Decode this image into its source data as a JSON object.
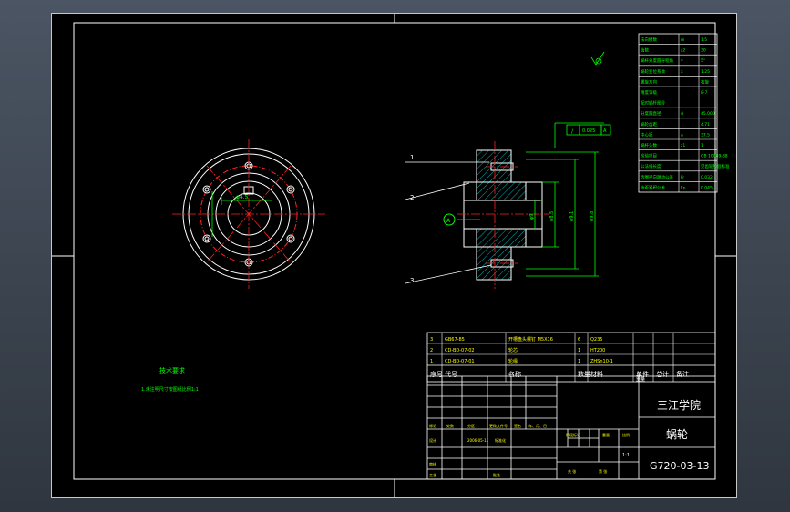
{
  "technical_requirements": {
    "heading": "技术要求",
    "item_1": "1.未注明尺寸按图纸比例1:1"
  },
  "section_views": {
    "left_circle_dim": "φ4.5",
    "view_marker": "A"
  },
  "side_view": {
    "callouts": [
      "1",
      "2",
      "3"
    ],
    "datum_tolerance": [
      "/",
      "0.025",
      "A"
    ],
    "diameter_labels": [
      "φ9",
      "φ8.5",
      "φ9.1",
      "φ9.8"
    ]
  },
  "parameter_table": {
    "rows": [
      [
        "法向模数",
        "m",
        "1.5"
      ],
      [
        "齿数",
        "z2",
        "30"
      ],
      [
        "蜗杆分度圆导程角",
        "γ",
        "5°"
      ],
      [
        "蜗轮变位系数",
        "x",
        "1.25"
      ],
      [
        "螺旋方向",
        "",
        "右旋"
      ],
      [
        "精度等级",
        "",
        "8-7"
      ],
      [
        "配对蜗杆图号",
        "",
        ""
      ],
      [
        "分度圆直径",
        "d",
        "45.000"
      ],
      [
        "蜗轮齿距",
        "",
        "4.71"
      ],
      [
        "中心距",
        "a",
        "37.5"
      ],
      [
        "蜗杆头数",
        "z1",
        "1"
      ],
      [
        "检验项目",
        "",
        "GB 10089-88"
      ],
      [
        "公法线长度",
        "",
        "见齿轮检验标准"
      ],
      [
        "齿圈径向跳动公差",
        "Fr",
        "0.032"
      ],
      [
        "齿距累积公差",
        "Fp",
        "0.045"
      ]
    ]
  },
  "parts_list": {
    "rows": [
      [
        "3",
        "GB67-85",
        "开槽盘头螺钉 M5X16",
        "6",
        "Q235",
        "",
        "",
        ""
      ],
      [
        "2",
        "CD-BD-07-02",
        "轮芯",
        "1",
        "HT200",
        "",
        "",
        ""
      ],
      [
        "1",
        "CD-BD-07-01",
        "轮缘",
        "1",
        "ZHSn10-1",
        "",
        "",
        ""
      ]
    ],
    "header": [
      "序号",
      "代号",
      "名称",
      "数量",
      "材料",
      "单件",
      "总计",
      "备注"
    ],
    "weight_label": "重量"
  },
  "title_block": {
    "school": "三江学院",
    "part_name": "蜗轮",
    "drawing_number": "G720-03-13",
    "scale": "1:1",
    "labels": {
      "mark": "标记",
      "count": "处数",
      "zone": "分区",
      "change_doc": "更改文件号",
      "sign": "签名",
      "date": "年、月、日",
      "designer": "设计",
      "design_date": "2006-05-11",
      "standardize": "标准化",
      "review": "审核",
      "process": "工艺",
      "approve": "批准",
      "stage_mark": "阶段标记",
      "weight": "重量",
      "scale_label": "比例",
      "sheets_total": "共 张",
      "sheet_no": "第 张"
    }
  },
  "colors": {
    "background": "#000000",
    "lines": "#ffffff",
    "dimensions": "#00ff00",
    "text": "#ffff00",
    "centerlines": "#ff2020",
    "hatch": "#00c0c0"
  }
}
